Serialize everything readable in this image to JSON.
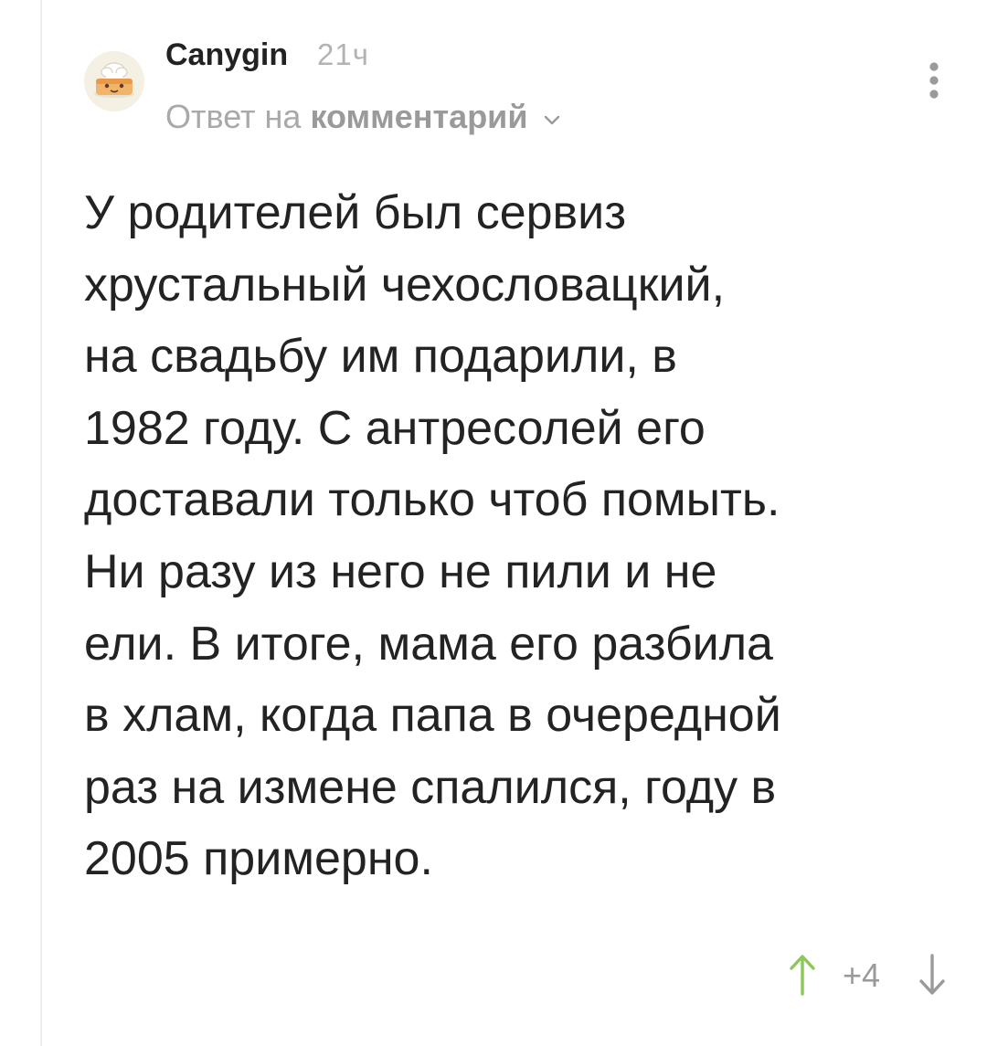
{
  "comment": {
    "author": "Canygin",
    "time": "21ч",
    "reply_prefix": "Ответ на",
    "reply_link": "комментарий",
    "text_lines": [
      "У родителей был сервиз",
      "хрустальный чехословацкий,",
      "на свадьбу им подарили, в",
      "1982 году. С антресолей его",
      "доставали только чтоб помыть.",
      "Ни разу из него не пили и не",
      "ели. В итоге, мама его разбила",
      "в хлам, когда папа в очередной",
      "раз на измене спалился, году в",
      "2005 примерно."
    ],
    "rating": "+4"
  },
  "icons": {
    "avatar": "cartoon-avatar",
    "reply_toggle": "chevron-down-icon",
    "menu": "more-vertical-icon",
    "upvote": "arrow-up-icon",
    "downvote": "arrow-down-icon"
  },
  "colors": {
    "upvote": "#8ac858",
    "downvote": "#9a9a9a",
    "muted_text": "#a9a9a9",
    "thread_line": "#ededed"
  }
}
